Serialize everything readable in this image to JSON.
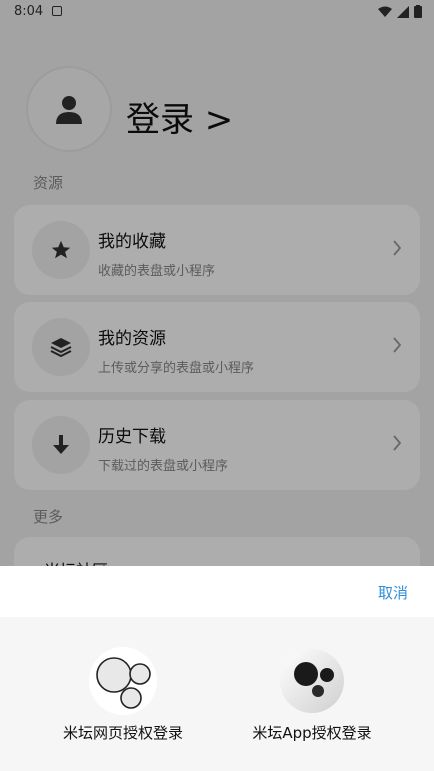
{
  "status_bar": {
    "time": "8:04"
  },
  "profile": {
    "login_label": "登录 >"
  },
  "sections": {
    "resources": "资源",
    "more": "更多"
  },
  "cards": [
    {
      "title": "我的收藏",
      "subtitle": "收藏的表盘或小程序",
      "icon": "star-icon"
    },
    {
      "title": "我的资源",
      "subtitle": "上传或分享的表盘或小程序",
      "icon": "layers-icon"
    },
    {
      "title": "历史下载",
      "subtitle": "下载过的表盘或小程序",
      "icon": "download-arrow-icon"
    }
  ],
  "partial_item": {
    "title": "米坛社区"
  },
  "sheet": {
    "cancel_label": "取消",
    "options": [
      {
        "label": "米坛网页授权登录",
        "icon": "web-login-logo-icon"
      },
      {
        "label": "米坛App授权登录",
        "icon": "app-login-logo-icon"
      }
    ]
  },
  "colors": {
    "accent": "#2f8fd8",
    "overlay": "rgba(0,0,0,0.32)"
  }
}
